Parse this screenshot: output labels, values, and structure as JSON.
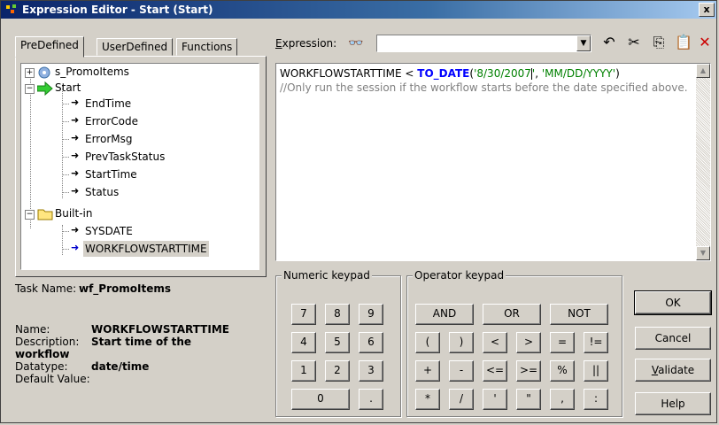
{
  "window": {
    "title": "Expression Editor - Start (Start)",
    "close_label": "x"
  },
  "tabs": [
    {
      "label": "PreDefined",
      "active": true
    },
    {
      "label": "UserDefined",
      "active": false
    },
    {
      "label": "Functions",
      "active": false
    }
  ],
  "tree": {
    "root_label": "s_PromoItems",
    "start_label": "Start",
    "start_children": [
      "EndTime",
      "ErrorCode",
      "ErrorMsg",
      "PrevTaskStatus",
      "StartTime",
      "Status"
    ],
    "builtin_label": "Built-in",
    "builtin_children": [
      "SYSDATE",
      "WORKFLOWSTARTTIME"
    ],
    "selected": "WORKFLOWSTARTTIME"
  },
  "info": {
    "task_name_label": "Task Name:",
    "task_name": "wf_PromoItems",
    "name_label": "Name:",
    "name": "WORKFLOWSTARTTIME",
    "description_label": "Description:",
    "description_line1": "Start time of the",
    "description_line2": "workflow",
    "datatype_label": "Datatype:",
    "datatype": "date/time",
    "default_label": "Default Value:"
  },
  "expression": {
    "label_prefix": "E",
    "label_rest": "xpression:",
    "combo_value": "",
    "line1_var": "WORKFLOWSTARTTIME < ",
    "line1_func": "TO_DATE",
    "line1_open": "(",
    "line1_arg1": "'8/30/2007",
    "line1_arg1_end": "'",
    "line1_sep": ", ",
    "line1_arg2": "'MM/DD/YYYY'",
    "line1_close": ")",
    "line2_comment": "//Only run the session if the workflow starts before the date specified above."
  },
  "numeric_keypad": {
    "title": "Numeric keypad",
    "keys": [
      "7",
      "8",
      "9",
      "4",
      "5",
      "6",
      "1",
      "2",
      "3",
      "0",
      "."
    ]
  },
  "operator_keypad": {
    "title": "Operator keypad",
    "row1": [
      "AND",
      "OR",
      "NOT"
    ],
    "row2": [
      "(",
      ")",
      "<",
      ">",
      "=",
      "!="
    ],
    "row3": [
      "+",
      "-",
      "<=",
      ">=",
      "%",
      "||"
    ],
    "row4": [
      "*",
      "/",
      "'",
      "\"",
      ",",
      ":"
    ]
  },
  "buttons": {
    "ok": "OK",
    "cancel": "Cancel",
    "validate_prefix": "V",
    "validate_rest": "alidate",
    "help": "Help"
  },
  "colors": {
    "keyword": "#0000ff",
    "string": "#008000",
    "comment": "#808080",
    "title_start": "#0a246a"
  }
}
